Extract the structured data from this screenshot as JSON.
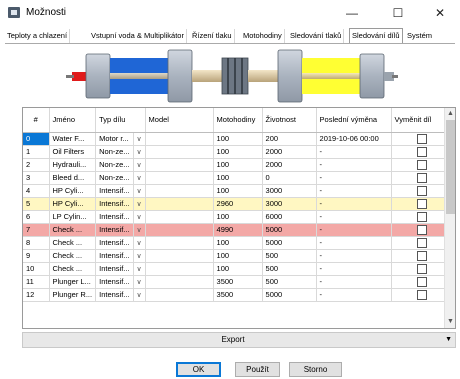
{
  "window": {
    "title": "Možnosti",
    "minimize_glyph": "—",
    "maximize_glyph": "☐",
    "close_glyph": "✕"
  },
  "tabs": [
    {
      "label": "Teploty a chlazení"
    },
    {
      "label": "Vstupní voda & Multiplikátor"
    },
    {
      "label": "Řízení tlaku"
    },
    {
      "label": "Motohodiny"
    },
    {
      "label": "Sledování tlaků"
    },
    {
      "label": "Sledování dílů",
      "active": true
    },
    {
      "label": "Systém"
    }
  ],
  "colors": {
    "blue_section": "#1f66d6",
    "yellow_section": "#ffff33",
    "row_highlight_yellow": "#fff7c2",
    "row_highlight_red": "#f3a8a6",
    "selected_accent": "#0a78d6"
  },
  "table": {
    "headers": [
      "#",
      "Jméno",
      "Typ dílu",
      "Model",
      "Motohodiny",
      "Životnost",
      "Poslední výměna",
      "Vyměnit díl"
    ],
    "rows": [
      {
        "num": "0",
        "name": "Water F...",
        "type": "Motor r...",
        "model": "",
        "hours": "100",
        "life": "200",
        "last": "2019-10-06 00:00",
        "style": "sel"
      },
      {
        "num": "1",
        "name": "Oil Filters",
        "type": "Non-ze...",
        "model": "",
        "hours": "100",
        "life": "2000",
        "last": "-",
        "style": ""
      },
      {
        "num": "2",
        "name": "Hydrauli...",
        "type": "Non-ze...",
        "model": "",
        "hours": "100",
        "life": "2000",
        "last": "-",
        "style": ""
      },
      {
        "num": "3",
        "name": "Bleed d...",
        "type": "Non-ze...",
        "model": "",
        "hours": "100",
        "life": "0",
        "last": "-",
        "style": ""
      },
      {
        "num": "4",
        "name": "HP Cyli...",
        "type": "Intensif...",
        "model": "",
        "hours": "100",
        "life": "3000",
        "last": "-",
        "style": ""
      },
      {
        "num": "5",
        "name": "HP Cyli...",
        "type": "Intensif...",
        "model": "",
        "hours": "2960",
        "life": "3000",
        "last": "-",
        "style": "hl-yellow"
      },
      {
        "num": "6",
        "name": "LP Cylin...",
        "type": "Intensif...",
        "model": "",
        "hours": "100",
        "life": "6000",
        "last": "-",
        "style": ""
      },
      {
        "num": "7",
        "name": "Check ...",
        "type": "Intensif...",
        "model": "",
        "hours": "4990",
        "life": "5000",
        "last": "-",
        "style": "hl-red"
      },
      {
        "num": "8",
        "name": "Check ...",
        "type": "Intensif...",
        "model": "",
        "hours": "100",
        "life": "5000",
        "last": "-",
        "style": ""
      },
      {
        "num": "9",
        "name": "Check ...",
        "type": "Intensif...",
        "model": "",
        "hours": "100",
        "life": "500",
        "last": "-",
        "style": ""
      },
      {
        "num": "10",
        "name": "Check ...",
        "type": "Intensif...",
        "model": "",
        "hours": "100",
        "life": "500",
        "last": "-",
        "style": ""
      },
      {
        "num": "11",
        "name": "Plunger L...",
        "type": "Intensif...",
        "model": "",
        "hours": "3500",
        "life": "500",
        "last": "-",
        "style": ""
      },
      {
        "num": "12",
        "name": "Plunger R...",
        "type": "Intensif...",
        "model": "",
        "hours": "3500",
        "life": "5000",
        "last": "-",
        "style": ""
      }
    ]
  },
  "export": {
    "label": "Export"
  },
  "buttons": {
    "ok": "OK",
    "apply": "Použít",
    "cancel": "Storno"
  }
}
